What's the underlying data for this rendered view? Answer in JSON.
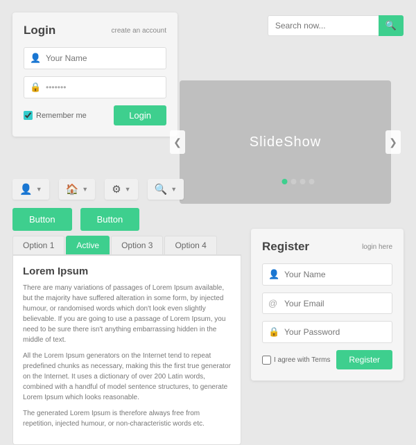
{
  "login": {
    "title": "Login",
    "create_account": "create an account",
    "name_placeholder": "Your Name",
    "password_placeholder": "•••••••",
    "remember_label": "Remember me",
    "login_btn": "Login"
  },
  "search": {
    "placeholder": "Search now...",
    "btn_icon": "🔍"
  },
  "slideshow": {
    "label": "SlideShow",
    "dots": [
      true,
      false,
      false,
      false
    ],
    "arrow_left": "❮",
    "arrow_right": "❯"
  },
  "toolbar": {
    "items": [
      {
        "icon": "👤",
        "name": "user-menu"
      },
      {
        "icon": "🏠",
        "name": "home-menu"
      },
      {
        "icon": "⚙",
        "name": "settings-menu"
      },
      {
        "icon": "🔍",
        "name": "search-menu"
      }
    ]
  },
  "buttons": {
    "btn1": "Button",
    "btn2": "Button"
  },
  "tabs": {
    "items": [
      {
        "label": "Option 1",
        "active": false
      },
      {
        "label": "Active",
        "active": true
      },
      {
        "label": "Option 3",
        "active": false
      },
      {
        "label": "Option 4",
        "active": false
      }
    ],
    "content_title": "Lorem Ipsum",
    "content_p1": "There are many variations of passages of Lorem Ipsum available, but the majority have suffered alteration in some form, by injected humour, or randomised words which don't look even slightly believable. If you are going to use a passage of Lorem Ipsum, you need to be sure there isn't anything embarrassing hidden in the middle of text.",
    "content_p2": "All the Lorem Ipsum generators on the Internet tend to repeat predefined chunks as necessary, making this the first true generator on the Internet. It uses a dictionary of over 200 Latin words, combined with a handful of model sentence structures, to generate Lorem Ipsum which looks reasonable.",
    "content_p3": "The generated Lorem Ipsum is therefore always free from repetition, injected humour, or non-characteristic words etc."
  },
  "register": {
    "title": "Register",
    "login_here": "login here",
    "name_placeholder": "Your Name",
    "email_placeholder": "Your Email",
    "password_placeholder": "Your Password",
    "agree_label": "I agree with Terms",
    "register_btn": "Register"
  }
}
